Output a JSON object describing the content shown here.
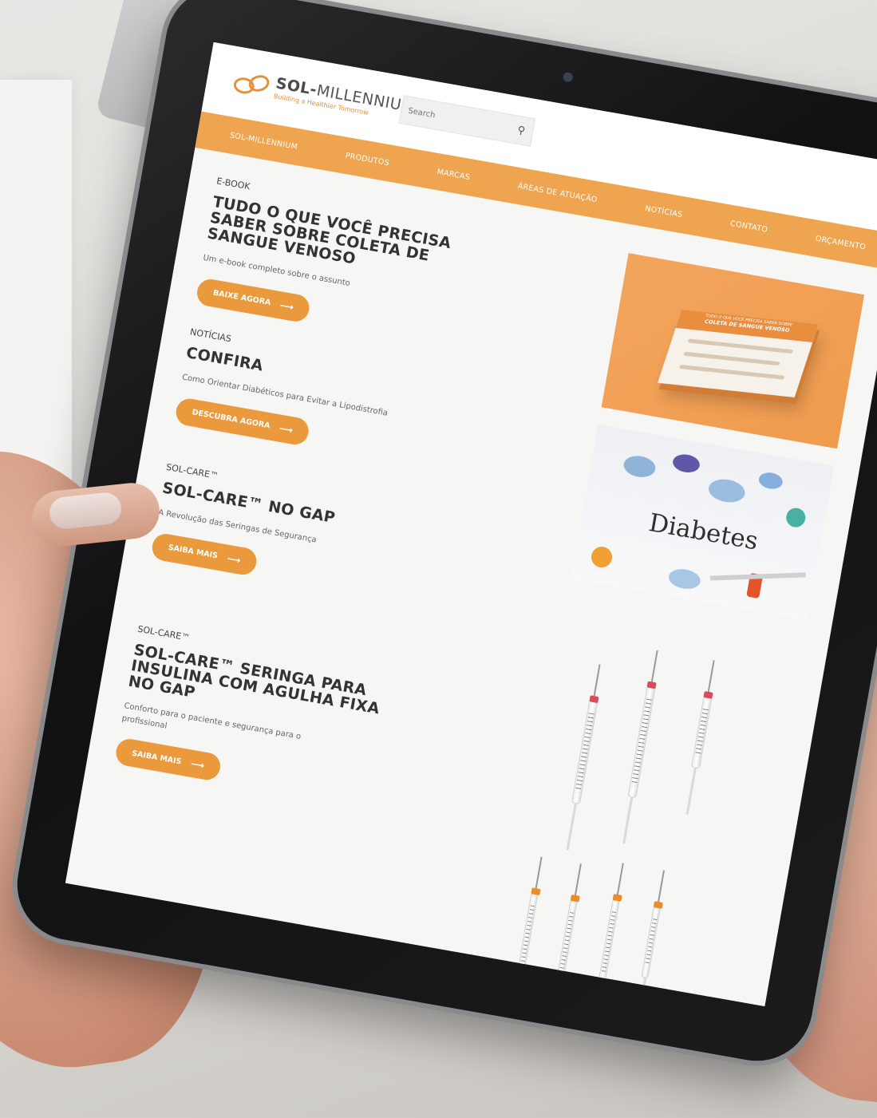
{
  "logo": {
    "name_bold": "SOL-",
    "name_rest": "MILLENNIUM",
    "trademark": "®",
    "tagline": "Building a Healthier Tomorrow"
  },
  "search": {
    "placeholder": "Search",
    "icon": "search-icon"
  },
  "nav": {
    "items": [
      "SOL-MILLENNIUM",
      "PRODUTOS",
      "MARCAS",
      "ÁREAS DE ATUAÇÃO",
      "NOTÍCIAS",
      "CONTATO",
      "ORÇAMENTO"
    ]
  },
  "sections": [
    {
      "eyebrow": "E-BOOK",
      "title": "TUDO O QUE VOCÊ PRECISA SABER SOBRE COLETA DE SANGUE VENOSO",
      "description": "Um e-book completo sobre o assunto",
      "cta": "BAIXE AGORA"
    },
    {
      "eyebrow": "NOTÍCIAS",
      "title": "CONFIRA",
      "description": "Como Orientar Diabéticos para Evitar a Lipodistrofia",
      "cta": "DESCUBRA AGORA"
    },
    {
      "eyebrow": "SOL-CARE™",
      "title": "SOL-CARE™ NO GAP",
      "description": "A Revolução das Seringas de Segurança",
      "cta": "SAIBA MAIS"
    },
    {
      "eyebrow": "SOL-CARE™",
      "title": "SOL-CARE™ SERINGA PARA INSULINA COM AGULHA FIXA NO GAP",
      "description": "Conforto para o paciente e segurança para o profissional",
      "cta": "SAIBA MAIS"
    }
  ],
  "media": {
    "ebook_cover": {
      "small_title": "TUDO O QUE VOCÊ PRECISA SABER SOBRE",
      "big_title": "COLETA DE SANGUE VENOSO"
    },
    "diabetes_label": "Diabetes"
  },
  "colors": {
    "accent": "#efa54f",
    "button": "#ea9a3c",
    "text_dark": "#333333",
    "tablet_bezel": "#111113"
  }
}
